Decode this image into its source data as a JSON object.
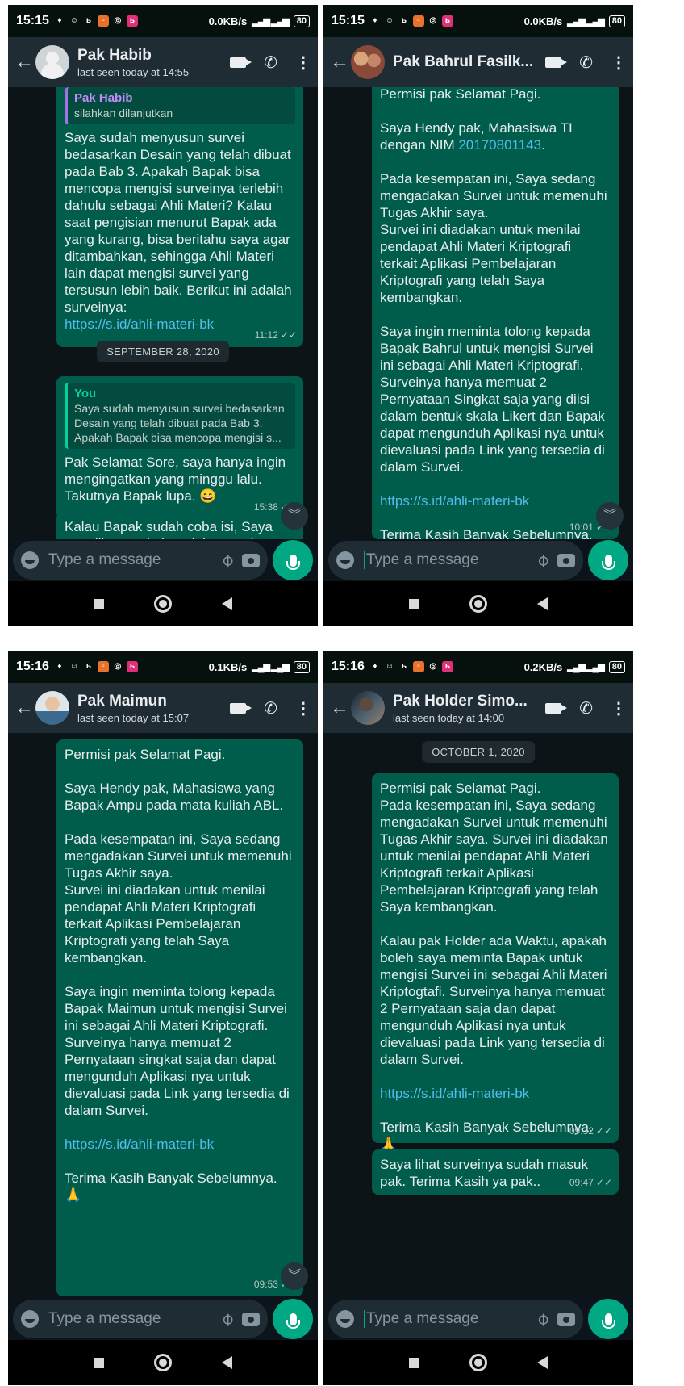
{
  "panels": [
    {
      "status": {
        "time": "15:15",
        "speed": "0.0KB/s",
        "battery": "80"
      },
      "contact": {
        "name": "Pak Habib",
        "status": "last seen today at 14:55"
      },
      "messages": [
        {
          "quote_name": "Pak Habib",
          "quote_text": "silahkan dilanjutkan",
          "text": "Saya sudah menyusun survei bedasarkan Desain yang telah dibuat pada Bab 3. Apakah Bapak bisa mencopa mengisi surveinya terlebih dahulu sebagai Ahli Materi? Kalau saat pengisian menurut Bapak ada yang kurang, bisa beritahu saya agar ditambahkan, sehingga Ahli Materi lain dapat mengisi survei yang tersusun lebih baik. Berikut ini adalah surveinya:",
          "link": "https://s.id/ahli-materi-bk",
          "time": "11:12",
          "ticks": "✓✓"
        },
        {
          "quote_name": "You",
          "quote_text": "Saya sudah menyusun survei bedasarkan Desain yang telah dibuat pada Bab 3. Apakah Bapak bisa mencopa mengisi s...",
          "text": "Pak Selamat Sore, saya hanya ingin mengingatkan yang minggu lalu. Takutnya Bapak lupa. 😄",
          "time": "15:38",
          "ticks": "✓✓"
        },
        {
          "text": "Kalau Bapak sudah coba isi, Saya mau lihat apakah sudah sesuai"
        }
      ],
      "date_chip": "SEPTEMBER 28, 2020",
      "input_placeholder": "Type a message"
    },
    {
      "status": {
        "time": "15:15",
        "speed": "0.0KB/s",
        "battery": "80"
      },
      "contact": {
        "name": "Pak Bahrul Fasilk..."
      },
      "messages": [
        {
          "text_1": "Permisi pak Selamat Pagi.\n\nSaya Hendy pak, Mahasiswa TI\ndengan NIM ",
          "nim": "20170801143",
          "text_2": ".\n\nPada kesempatan ini, Saya sedang mengadakan Survei untuk memenuhi Tugas Akhir saya.\nSurvei ini diadakan untuk menilai pendapat Ahli Materi Kriptografi terkait Aplikasi Pembelajaran Kriptografi yang telah Saya kembangkan.\n\nSaya ingin meminta tolong kepada Bapak Bahrul untuk mengisi Survei ini sebagai Ahli Materi Kriptografi. Surveinya hanya memuat 2 Pernyataan Singkat saja yang diisi dalam bentuk skala Likert dan Bapak dapat mengunduh Aplikasi nya untuk dievaluasi pada Link yang tersedia di dalam Survei.",
          "link": "https://s.id/ahli-materi-bk",
          "closing": "Terima Kasih Banyak Sebelumnya.\n🙏",
          "time": "10:01",
          "ticks": "✓✓"
        }
      ],
      "input_placeholder": "Type a message"
    },
    {
      "status": {
        "time": "15:16",
        "speed": "0.1KB/s",
        "battery": "80"
      },
      "contact": {
        "name": "Pak Maimun",
        "status": "last seen today at 15:07"
      },
      "messages": [
        {
          "text": "Permisi pak Selamat Pagi.\n\nSaya Hendy pak, Mahasiswa yang Bapak Ampu pada mata kuliah ABL.\n\nPada kesempatan ini, Saya sedang mengadakan Survei untuk memenuhi Tugas Akhir saya.\nSurvei ini diadakan untuk menilai pendapat Ahli Materi Kriptografi terkait Aplikasi Pembelajaran Kriptografi yang telah Saya kembangkan.\n\nSaya ingin meminta tolong kepada Bapak Maimun untuk mengisi Survei ini sebagai Ahli Materi Kriptografi. Surveinya hanya memuat 2 Pernyataan singkat saja dan dapat mengunduh Aplikasi nya untuk dievaluasi pada Link yang tersedia di dalam Survei.",
          "link": "https://s.id/ahli-materi-bk",
          "closing": "Terima Kasih Banyak Sebelumnya.\n🙏",
          "time": "09:53",
          "ticks": "✓✓"
        }
      ],
      "input_placeholder": "Type a message"
    },
    {
      "status": {
        "time": "15:16",
        "speed": "0.2KB/s",
        "battery": "80"
      },
      "contact": {
        "name": "Pak Holder Simo...",
        "status": "last seen today at 14:00"
      },
      "date_chip": "OCTOBER 1, 2020",
      "messages": [
        {
          "text": "Permisi pak Selamat Pagi.\nPada kesempatan ini, Saya sedang mengadakan Survei untuk memenuhi Tugas Akhir saya. Survei ini diadakan untuk menilai pendapat Ahli Materi Kriptografi terkait Aplikasi Pembelajaran Kriptografi yang telah Saya kembangkan.\n\nKalau pak Holder ada Waktu, apakah boleh saya meminta Bapak untuk mengisi Survei ini sebagai Ahli Materi Kriptogtafi. Surveinya hanya memuat 2 Pernyataan saja dan dapat mengunduh Aplikasi nya untuk dievaluasi pada Link yang tersedia di dalam Survei.",
          "link": "https://s.id/ahli-materi-bk",
          "closing": "Terima Kasih Banyak Sebelumnya.\n🙏",
          "time": "09:32",
          "ticks": "✓✓"
        },
        {
          "text": "Saya lihat surveinya sudah masuk pak. Terima Kasih ya pak..",
          "time": "09:47",
          "ticks": "✓✓"
        }
      ],
      "input_placeholder": "Type a message"
    }
  ],
  "icons": {
    "back": "arrow-left-icon",
    "video": "video-call-icon",
    "phone": "phone-icon",
    "menu": "kebab-menu-icon",
    "emoji": "emoji-icon",
    "attach": "paperclip-icon",
    "camera": "camera-icon",
    "mic": "mic-icon",
    "scroll": "double-chevron-down-icon"
  },
  "colors": {
    "outgoing_bubble": "#005c4b",
    "header": "#1f2c33",
    "accent": "#00a884",
    "link": "#53bdeb"
  }
}
